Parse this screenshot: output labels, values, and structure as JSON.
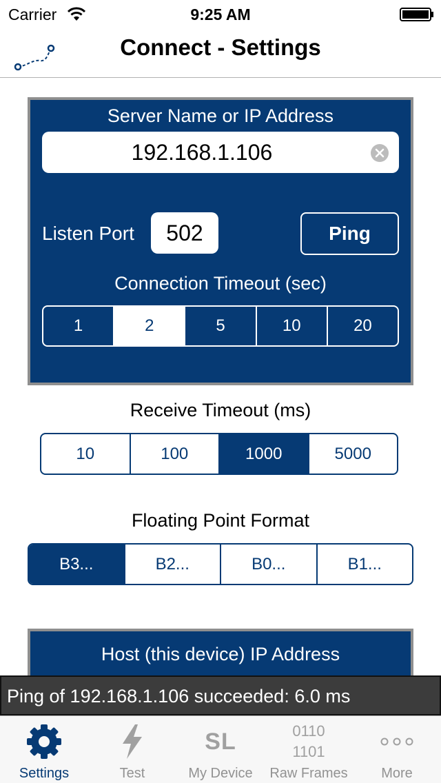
{
  "status_bar": {
    "carrier": "Carrier",
    "time": "9:25 AM"
  },
  "nav": {
    "title": "Connect - Settings"
  },
  "server": {
    "heading": "Server Name or IP Address",
    "address": "192.168.1.106",
    "port_label": "Listen Port",
    "port_value": "502",
    "ping_label": "Ping",
    "conn_timeout_label": "Connection Timeout (sec)",
    "conn_timeout_options": [
      "1",
      "2",
      "5",
      "10",
      "20"
    ],
    "conn_timeout_selected": "2"
  },
  "receive": {
    "label": "Receive Timeout (ms)",
    "options": [
      "10",
      "100",
      "1000",
      "5000"
    ],
    "selected": "1000"
  },
  "float_format": {
    "label": "Floating Point Format",
    "options": [
      "B3...",
      "B2...",
      "B0...",
      "B1..."
    ],
    "selected": "B3..."
  },
  "host": {
    "heading": "Host (this device) IP Address"
  },
  "toast": {
    "message": "Ping of 192.168.1.106 succeeded: 6.0 ms"
  },
  "tabs": [
    {
      "label": "Settings",
      "icon": "gear-icon",
      "active": true
    },
    {
      "label": "Test",
      "icon": "lightning-icon",
      "active": false
    },
    {
      "label": "My Device",
      "icon": "sl-logo-icon",
      "glyph": "SL",
      "active": false
    },
    {
      "label": "Raw Frames",
      "icon": "binary-icon",
      "glyph_lines": [
        "0110",
        "1101"
      ],
      "active": false
    },
    {
      "label": "More",
      "icon": "more-icon",
      "active": false
    }
  ],
  "colors": {
    "brand_blue": "#063a74",
    "panel_border": "#8f8f8f",
    "toast_bg": "#3c3c3c",
    "tab_inactive": "#929292"
  }
}
